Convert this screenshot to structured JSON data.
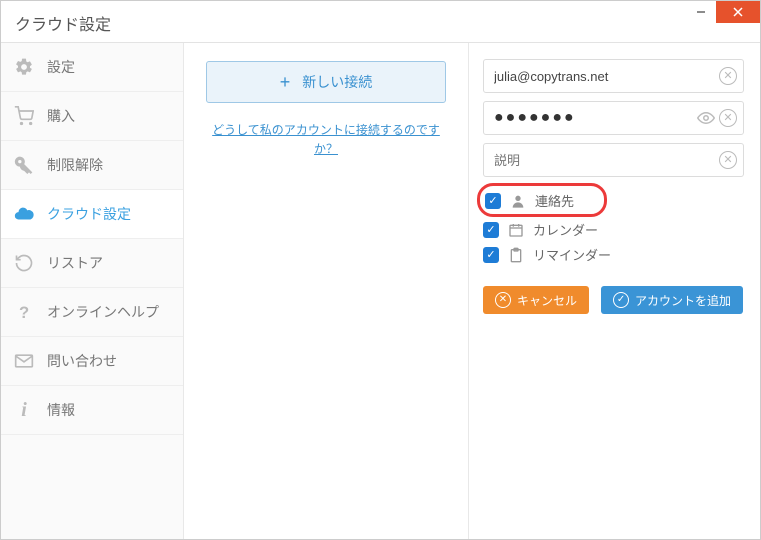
{
  "window": {
    "title": "クラウド設定"
  },
  "sidebar": {
    "items": [
      {
        "label": "設定"
      },
      {
        "label": "購入"
      },
      {
        "label": "制限解除"
      },
      {
        "label": "クラウド設定"
      },
      {
        "label": "リストア"
      },
      {
        "label": "オンラインヘルプ"
      },
      {
        "label": "問い合わせ"
      },
      {
        "label": "情報"
      }
    ]
  },
  "middle": {
    "new_connection": "新しい接続",
    "help_link": "どうして私のアカウントに接続するのですか？"
  },
  "form": {
    "email_value": "julia@copytrans.net",
    "password_mask": "●●●●●●●",
    "description_placeholder": "説明"
  },
  "options": {
    "contacts": "連絡先",
    "calendar": "カレンダー",
    "reminders": "リマインダー"
  },
  "buttons": {
    "cancel": "キャンセル",
    "add_account": "アカウントを追加"
  },
  "colors": {
    "accent": "#3aa0e0",
    "close": "#e6522c",
    "highlight_ring": "#ec3a3a",
    "cancel_btn": "#f08b2c",
    "add_btn": "#3a94d6"
  }
}
